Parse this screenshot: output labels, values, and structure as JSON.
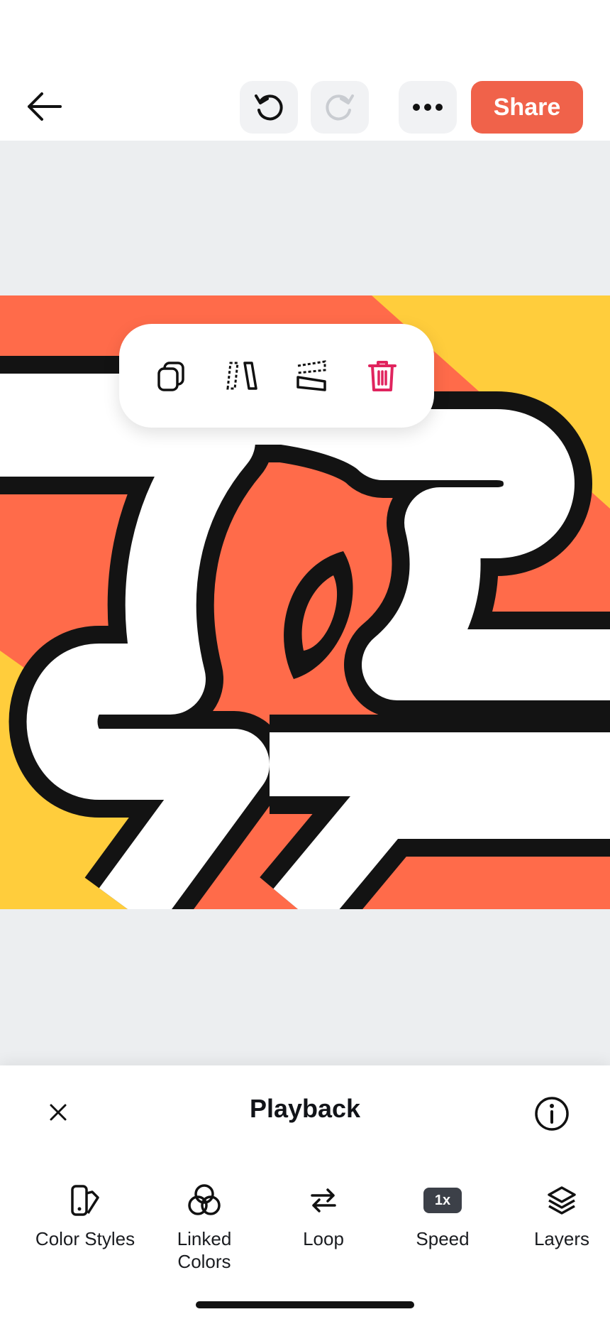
{
  "topbar": {
    "share_label": "Share"
  },
  "panel": {
    "title": "Playback",
    "options": [
      {
        "label": "Color Styles",
        "icon": "color-styles-icon"
      },
      {
        "label": "Linked\nColors",
        "icon": "linked-colors-icon"
      },
      {
        "label": "Loop",
        "icon": "loop-icon"
      },
      {
        "label": "Speed",
        "icon": "speed-icon",
        "badge": "1x"
      },
      {
        "label": "Layers",
        "icon": "layers-icon"
      }
    ]
  },
  "colors": {
    "accent": "#f0624a",
    "artwork_orange": "#ff6b4a",
    "artwork_yellow": "#ffcd3c",
    "canvas_bg": "#eceef0",
    "delete_red": "#e0245e"
  }
}
